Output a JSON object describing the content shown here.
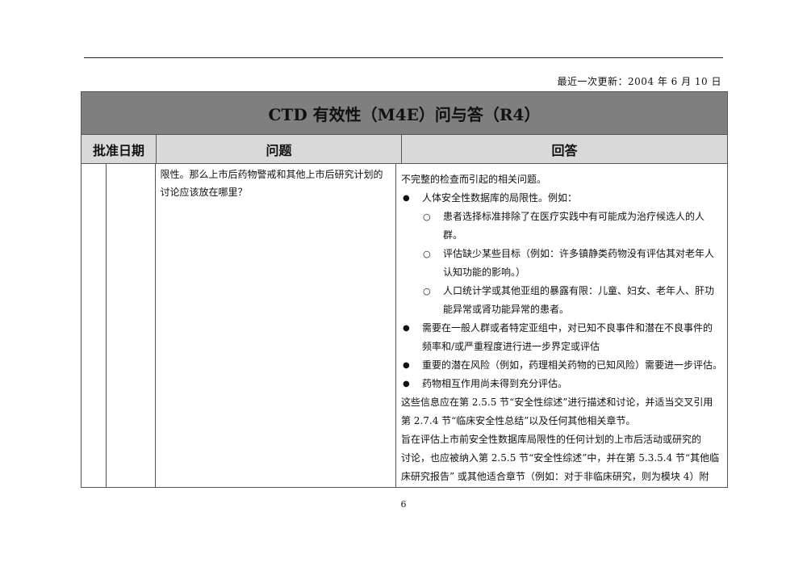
{
  "header": {
    "last_updated": "最近一次更新：2004 年 6 月 10 日"
  },
  "table": {
    "title": "CTD 有效性（M4E）问与答（R4）",
    "columns": {
      "date": "批准日期",
      "question": "问题",
      "answer": "回答"
    },
    "question_lines": [
      "限性。那么上市后药物警戒和其他上市后研究计划的",
      "讨论应该放在哪里？"
    ],
    "answer": {
      "intro": "不完整的检查而引起的相关问题。",
      "bullet1": "人体安全性数据库的局限性。例如：",
      "sub1_line1": "患者选择标准排除了在医疗实践中有可能成为治疗候选人的人",
      "sub1_line2": "群。",
      "sub2_line1": "评估缺少某些目标（例如：许多镇静类药物没有评估其对老年人",
      "sub2_line2": "认知功能的影响。）",
      "sub3_line1": "人口统计学或其他亚组的暴露有限：儿童、妇女、老年人、肝功",
      "sub3_line2": "能异常或肾功能异常的患者。",
      "bullet2_line1": "需要在一般人群或者特定亚组中，对已知不良事件和潜在不良事件的",
      "bullet2_line2": "频率和/或严重程度进行进一步界定或评估",
      "bullet3": "重要的潜在风险（例如，药理相关药物的已知风险）需要进一步评估。",
      "bullet4": "药物相互作用尚未得到充分评估。",
      "para1_line1": "这些信息应在第 2.5.5 节“安全性综述”进行描述和讨论，并适当交叉引用",
      "para1_line2": "第 2.7.4 节“临床安全性总结”以及任何其他相关章节。",
      "para2_line1": "旨在评估上市前安全性数据库局限性的任何计划的上市后活动或研究的",
      "para2_line2": "讨论，也应被纳入第 2.5.5 节“安全性综述”中，并在第 5.3.5.4 节“其他临",
      "para2_line3": "床研究报告” 或其他适合章节（例如：对于非临床研究，则为模块 4）附"
    }
  },
  "footer": {
    "page_number": "6"
  }
}
